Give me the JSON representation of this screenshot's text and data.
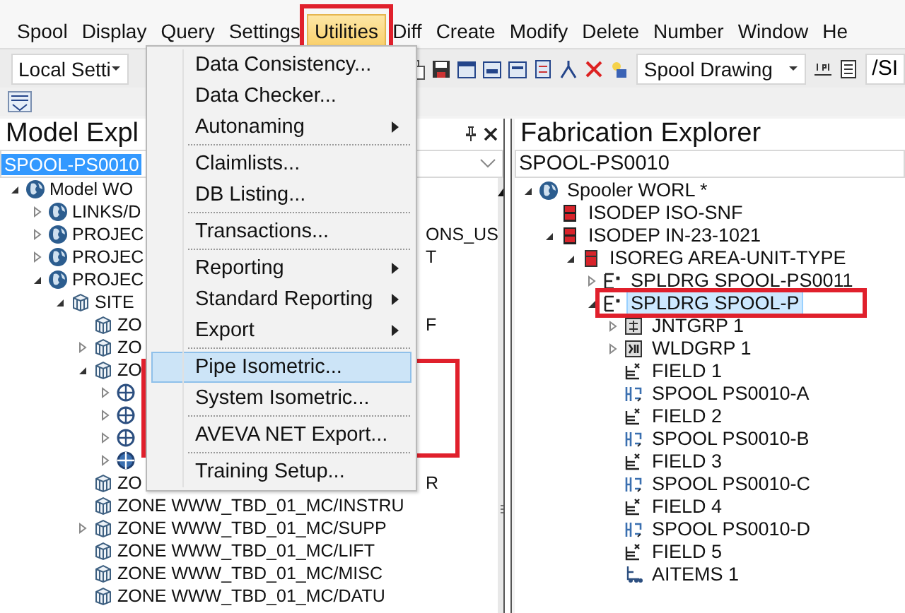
{
  "menubar": [
    {
      "label": "Spool",
      "selected": false
    },
    {
      "label": "Display",
      "selected": false
    },
    {
      "label": "Query",
      "selected": false
    },
    {
      "label": "Settings",
      "selected": false
    },
    {
      "label": "Utilities",
      "selected": true
    },
    {
      "label": "Diff",
      "selected": false
    },
    {
      "label": "Create",
      "selected": false
    },
    {
      "label": "Modify",
      "selected": false
    },
    {
      "label": "Delete",
      "selected": false
    },
    {
      "label": "Number",
      "selected": false
    },
    {
      "label": "Window",
      "selected": false
    },
    {
      "label": "He",
      "selected": false
    }
  ],
  "toolbar": {
    "settings_combo": "Local Setti",
    "drawing_combo": "Spool Drawing",
    "path_field": "/SI"
  },
  "utilities_menu": [
    {
      "kind": "item",
      "label": "Data Consistency...",
      "submenu": false,
      "selected": false
    },
    {
      "kind": "item",
      "label": "Data Checker...",
      "submenu": false,
      "selected": false
    },
    {
      "kind": "item",
      "label": "Autonaming",
      "submenu": true,
      "selected": false
    },
    {
      "kind": "separator"
    },
    {
      "kind": "item",
      "label": "Claimlists...",
      "submenu": false,
      "selected": false
    },
    {
      "kind": "item",
      "label": "DB Listing...",
      "submenu": false,
      "selected": false
    },
    {
      "kind": "separator"
    },
    {
      "kind": "item",
      "label": "Transactions...",
      "submenu": false,
      "selected": false
    },
    {
      "kind": "separator"
    },
    {
      "kind": "item",
      "label": "Reporting",
      "submenu": true,
      "selected": false
    },
    {
      "kind": "item",
      "label": "Standard Reporting",
      "submenu": true,
      "selected": false
    },
    {
      "kind": "item",
      "label": "Export",
      "submenu": true,
      "selected": false
    },
    {
      "kind": "separator"
    },
    {
      "kind": "item",
      "label": "Pipe Isometric...",
      "submenu": false,
      "selected": true
    },
    {
      "kind": "item",
      "label": "System Isometric...",
      "submenu": false,
      "selected": false
    },
    {
      "kind": "separator"
    },
    {
      "kind": "item",
      "label": "AVEVA NET Export...",
      "submenu": false,
      "selected": false
    },
    {
      "kind": "separator"
    },
    {
      "kind": "item",
      "label": "Training Setup...",
      "submenu": false,
      "selected": false
    }
  ],
  "model_explorer": {
    "title": "Model Expl",
    "filter": "SPOOL-PS0010",
    "tree": [
      {
        "kind": "world",
        "label": "Model WO",
        "expanded": true,
        "children": [
          {
            "kind": "world",
            "label": "LINKS/D",
            "expanded": false
          },
          {
            "kind": "world",
            "label": "PROJEC",
            "tail": "ONS_US",
            "expanded": false
          },
          {
            "kind": "world",
            "label": "PROJEC",
            "tail": "T",
            "expanded": false
          },
          {
            "kind": "world",
            "label": "PROJEC",
            "expanded": true,
            "children": [
              {
                "kind": "site",
                "label": "SITE",
                "expanded": true,
                "children": [
                  {
                    "kind": "zone",
                    "label": "ZO",
                    "tail": "F"
                  },
                  {
                    "kind": "zone",
                    "label": "ZO",
                    "expanded": false
                  },
                  {
                    "kind": "zone",
                    "label": "ZO",
                    "expanded": true,
                    "children": [
                      {
                        "kind": "pipe",
                        "expanded": false
                      },
                      {
                        "kind": "pipe",
                        "expanded": false
                      },
                      {
                        "kind": "pipe",
                        "expanded": false
                      },
                      {
                        "kind": "branch",
                        "expanded": false
                      }
                    ]
                  },
                  {
                    "kind": "zone",
                    "label": "ZO",
                    "tail": "R"
                  },
                  {
                    "kind": "zone",
                    "label": "ZONE WWW_TBD_01_MC/INSTRU"
                  },
                  {
                    "kind": "zone",
                    "label": "ZONE WWW_TBD_01_MC/SUPP",
                    "expanded": false
                  },
                  {
                    "kind": "zone",
                    "label": "ZONE WWW_TBD_01_MC/LIFT"
                  },
                  {
                    "kind": "zone",
                    "label": "ZONE WWW_TBD_01_MC/MISC"
                  },
                  {
                    "kind": "zone",
                    "label": "ZONE WWW_TBD_01_MC/DATU"
                  }
                ]
              }
            ]
          }
        ]
      }
    ]
  },
  "fabrication_explorer": {
    "title": "Fabrication Explorer",
    "filter": "SPOOL-PS0010",
    "tree": [
      {
        "kind": "world",
        "label": "Spooler WORL *",
        "expanded": true,
        "selected": false,
        "children": [
          {
            "kind": "isodep",
            "label": "ISODEP ISO-SNF",
            "selected": false
          },
          {
            "kind": "isodep",
            "label": "ISODEP IN-23-1021",
            "expanded": true,
            "selected": false,
            "children": [
              {
                "kind": "isoreg",
                "label": "ISOREG AREA-UNIT-TYPE",
                "expanded": true,
                "selected": false,
                "children": [
                  {
                    "kind": "spldrg",
                    "label": "SPLDRG SPOOL-PS0011",
                    "expanded": false,
                    "selected": false
                  },
                  {
                    "kind": "spldrg",
                    "label": "SPLDRG SPOOL-P",
                    "expanded": true,
                    "selected": true,
                    "children": [
                      {
                        "kind": "jntgrp",
                        "label": "JNTGRP 1",
                        "expanded": false,
                        "selected": false
                      },
                      {
                        "kind": "wldgrp",
                        "label": "WLDGRP 1",
                        "expanded": false,
                        "selected": false
                      },
                      {
                        "kind": "field",
                        "label": "FIELD 1",
                        "selected": false
                      },
                      {
                        "kind": "spool",
                        "label": "SPOOL PS0010-A",
                        "selected": false
                      },
                      {
                        "kind": "field",
                        "label": "FIELD 2",
                        "selected": false
                      },
                      {
                        "kind": "spool",
                        "label": "SPOOL PS0010-B",
                        "selected": false
                      },
                      {
                        "kind": "field",
                        "label": "FIELD 3",
                        "selected": false
                      },
                      {
                        "kind": "spool",
                        "label": "SPOOL PS0010-C",
                        "selected": false
                      },
                      {
                        "kind": "field",
                        "label": "FIELD 4",
                        "selected": false
                      },
                      {
                        "kind": "spool",
                        "label": "SPOOL PS0010-D",
                        "selected": false
                      },
                      {
                        "kind": "field",
                        "label": "FIELD 5",
                        "selected": false
                      },
                      {
                        "kind": "aitems",
                        "label": "AITEMS 1",
                        "selected": false
                      }
                    ]
                  }
                ]
              }
            ]
          }
        ]
      }
    ]
  }
}
